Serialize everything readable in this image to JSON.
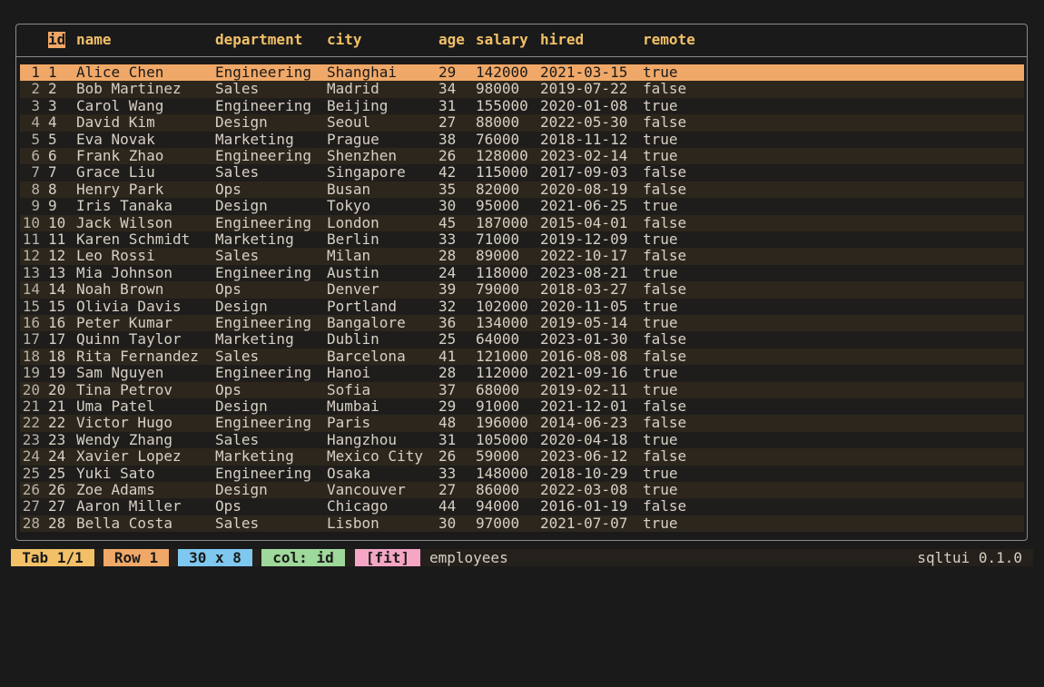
{
  "columns": [
    "id",
    "name",
    "department",
    "city",
    "age",
    "salary",
    "hired",
    "remote"
  ],
  "selected_row": 0,
  "rows": [
    [
      "1",
      "Alice Chen",
      "Engineering",
      "Shanghai",
      "29",
      "142000",
      "2021-03-15",
      "true"
    ],
    [
      "2",
      "Bob Martinez",
      "Sales",
      "Madrid",
      "34",
      "98000",
      "2019-07-22",
      "false"
    ],
    [
      "3",
      "Carol Wang",
      "Engineering",
      "Beijing",
      "31",
      "155000",
      "2020-01-08",
      "true"
    ],
    [
      "4",
      "David Kim",
      "Design",
      "Seoul",
      "27",
      "88000",
      "2022-05-30",
      "false"
    ],
    [
      "5",
      "Eva Novak",
      "Marketing",
      "Prague",
      "38",
      "76000",
      "2018-11-12",
      "true"
    ],
    [
      "6",
      "Frank Zhao",
      "Engineering",
      "Shenzhen",
      "26",
      "128000",
      "2023-02-14",
      "true"
    ],
    [
      "7",
      "Grace Liu",
      "Sales",
      "Singapore",
      "42",
      "115000",
      "2017-09-03",
      "false"
    ],
    [
      "8",
      "Henry Park",
      "Ops",
      "Busan",
      "35",
      "82000",
      "2020-08-19",
      "false"
    ],
    [
      "9",
      "Iris Tanaka",
      "Design",
      "Tokyo",
      "30",
      "95000",
      "2021-06-25",
      "true"
    ],
    [
      "10",
      "Jack Wilson",
      "Engineering",
      "London",
      "45",
      "187000",
      "2015-04-01",
      "false"
    ],
    [
      "11",
      "Karen Schmidt",
      "Marketing",
      "Berlin",
      "33",
      "71000",
      "2019-12-09",
      "true"
    ],
    [
      "12",
      "Leo Rossi",
      "Sales",
      "Milan",
      "28",
      "89000",
      "2022-10-17",
      "false"
    ],
    [
      "13",
      "Mia Johnson",
      "Engineering",
      "Austin",
      "24",
      "118000",
      "2023-08-21",
      "true"
    ],
    [
      "14",
      "Noah Brown",
      "Ops",
      "Denver",
      "39",
      "79000",
      "2018-03-27",
      "false"
    ],
    [
      "15",
      "Olivia Davis",
      "Design",
      "Portland",
      "32",
      "102000",
      "2020-11-05",
      "true"
    ],
    [
      "16",
      "Peter Kumar",
      "Engineering",
      "Bangalore",
      "36",
      "134000",
      "2019-05-14",
      "true"
    ],
    [
      "17",
      "Quinn Taylor",
      "Marketing",
      "Dublin",
      "25",
      "64000",
      "2023-01-30",
      "false"
    ],
    [
      "18",
      "Rita Fernandez",
      "Sales",
      "Barcelona",
      "41",
      "121000",
      "2016-08-08",
      "false"
    ],
    [
      "19",
      "Sam Nguyen",
      "Engineering",
      "Hanoi",
      "28",
      "112000",
      "2021-09-16",
      "true"
    ],
    [
      "20",
      "Tina Petrov",
      "Ops",
      "Sofia",
      "37",
      "68000",
      "2019-02-11",
      "true"
    ],
    [
      "21",
      "Uma Patel",
      "Design",
      "Mumbai",
      "29",
      "91000",
      "2021-12-01",
      "false"
    ],
    [
      "22",
      "Victor Hugo",
      "Engineering",
      "Paris",
      "48",
      "196000",
      "2014-06-23",
      "false"
    ],
    [
      "23",
      "Wendy Zhang",
      "Sales",
      "Hangzhou",
      "31",
      "105000",
      "2020-04-18",
      "true"
    ],
    [
      "24",
      "Xavier Lopez",
      "Marketing",
      "Mexico City",
      "26",
      "59000",
      "2023-06-12",
      "false"
    ],
    [
      "25",
      "Yuki Sato",
      "Engineering",
      "Osaka",
      "33",
      "148000",
      "2018-10-29",
      "true"
    ],
    [
      "26",
      "Zoe Adams",
      "Design",
      "Vancouver",
      "27",
      "86000",
      "2022-03-08",
      "true"
    ],
    [
      "27",
      "Aaron Miller",
      "Ops",
      "Chicago",
      "44",
      "94000",
      "2016-01-19",
      "false"
    ],
    [
      "28",
      "Bella Costa",
      "Sales",
      "Lisbon",
      "30",
      "97000",
      "2021-07-07",
      "true"
    ]
  ],
  "status": {
    "tab": "Tab 1/1",
    "row": "Row 1",
    "dims": "30 x 8",
    "col": "col: id",
    "fit": "[fit]",
    "table": "employees",
    "version": "sqltui 0.1.0"
  },
  "colors": {
    "header": "#f2c067",
    "selection": "#f0a868",
    "row_alt": "#2c261d"
  }
}
